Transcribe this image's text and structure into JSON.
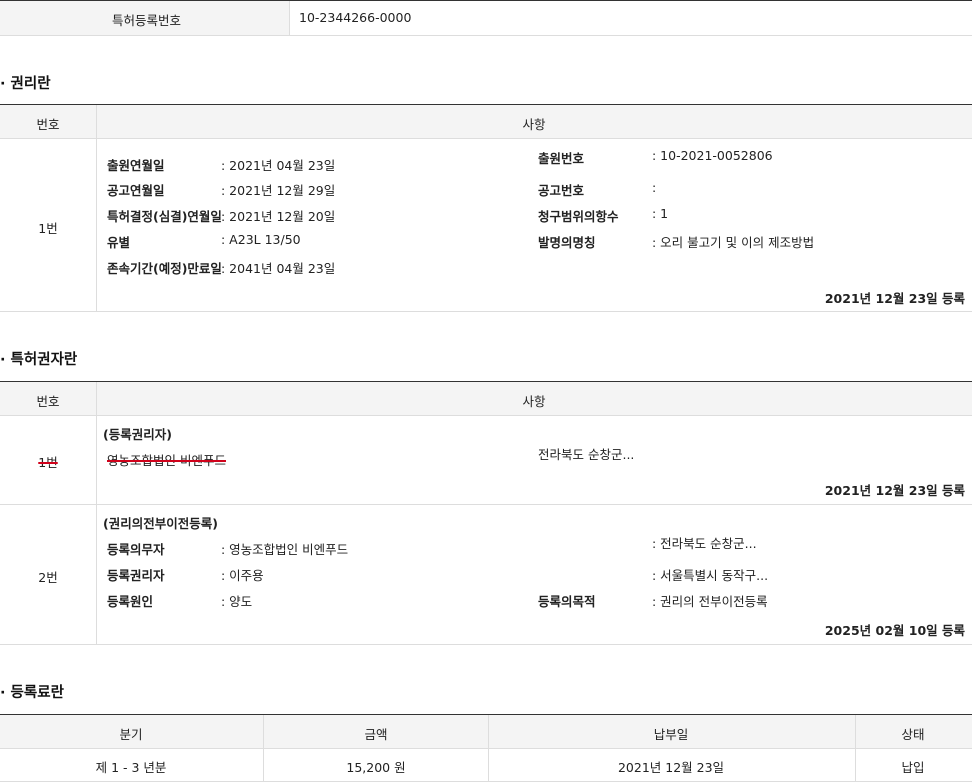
{
  "patent_reg": {
    "label": "특허등록번호",
    "value": "10-2344266-0000"
  },
  "rights": {
    "section_title": "· 권리란",
    "header": {
      "number": "번호",
      "matter": "사항"
    },
    "row": {
      "number": "1번",
      "left": [
        {
          "label": "출원연월일",
          "value": ": 2021년 04월 23일"
        },
        {
          "label": "공고연월일",
          "value": ": 2021년 12월 29일"
        },
        {
          "label": "특허결정(심결)연월일",
          "value": ": 2021년 12월 20일"
        },
        {
          "label": "유별",
          "value": ": A23L 13/50"
        },
        {
          "label": "존속기간(예정)만료일",
          "value": ": 2041년 04월 23일"
        }
      ],
      "right": [
        {
          "label": "출원번호",
          "value": ": 10-2021-0052806"
        },
        {
          "label": "공고번호",
          "value": ":"
        },
        {
          "label": "청구범위의항수",
          "value": ": 1"
        },
        {
          "label": "발명의명칭",
          "value": ": 오리 불고기 및 이의 제조방법"
        }
      ],
      "reg_date": "2021년 12월 23일 등록"
    }
  },
  "holders": {
    "section_title": "· 특허권자란",
    "header": {
      "number": "번호",
      "matter": "사항"
    },
    "row1": {
      "number": "1번",
      "heading": "(등록권리자)",
      "name": "영농조합법인 비엔푸드",
      "address": "전라북도 순창군...",
      "reg_date": "2021년 12월 23일 등록"
    },
    "row2": {
      "number": "2번",
      "heading": "(권리의전부이전등록)",
      "obligor_label": "등록의무자",
      "obligor_value": ": 영농조합법인 비엔푸드",
      "obligor_addr": ": 전라북도 순창군...",
      "holder_label": "등록권리자",
      "holder_value": ": 이주용",
      "holder_addr": ": 서울특별시 동작구...",
      "cause_label": "등록원인",
      "cause_value": ": 양도",
      "purpose_label": "등록의목적",
      "purpose_value": ": 권리의 전부이전등록",
      "reg_date": "2025년 02월 10일 등록"
    }
  },
  "fees": {
    "section_title": "· 등록료란",
    "headers": [
      "분기",
      "금액",
      "납부일",
      "상태"
    ],
    "rows": [
      [
        "제 1 - 3 년분",
        "15,200 원",
        "2021년 12월 23일",
        "납입"
      ]
    ]
  },
  "colors": {
    "strike": "#d0021b",
    "header_bg": "#f4f4f4",
    "border": "#dddddd"
  }
}
